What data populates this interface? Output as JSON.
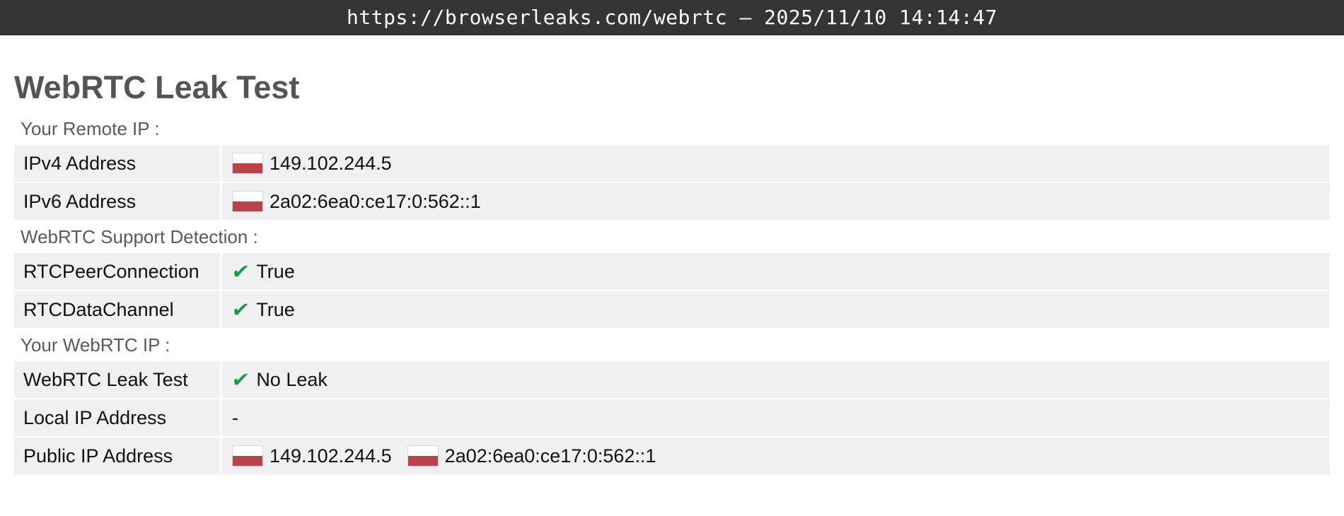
{
  "browser": {
    "url_bar_text": "https://browserleaks.com/webrtc – 2025/11/10 14:14:47"
  },
  "page": {
    "title": "WebRTC Leak Test"
  },
  "sections": [
    {
      "label": "Your Remote IP :",
      "rows": [
        {
          "label": "IPv4 Address",
          "value": "149.102.244.5",
          "icon": "poland-flag-icon"
        },
        {
          "label": "IPv6 Address",
          "value": "2a02:6ea0:ce17:0:562::1",
          "icon": "poland-flag-icon"
        }
      ]
    },
    {
      "label": "WebRTC Support Detection :",
      "rows": [
        {
          "label": "RTCPeerConnection",
          "value": "True",
          "icon": "checkmark-icon"
        },
        {
          "label": "RTCDataChannel",
          "value": "True",
          "icon": "checkmark-icon"
        }
      ]
    },
    {
      "label": "Your WebRTC IP :",
      "rows": [
        {
          "label": "WebRTC Leak Test",
          "value": "No Leak",
          "icon": "checkmark-icon"
        },
        {
          "label": "Local IP Address",
          "value": "-"
        },
        {
          "label": "Public IP Address",
          "value": "149.102.244.5",
          "icon": "poland-flag-icon",
          "value2": "2a02:6ea0:ce17:0:562::1",
          "icon2": "poland-flag-icon"
        }
      ]
    }
  ],
  "colors": {
    "url_bar_background": "#353535",
    "row_background": "#f0f0f3",
    "check_green": "#169c46",
    "flag_red": "#b8434a"
  }
}
